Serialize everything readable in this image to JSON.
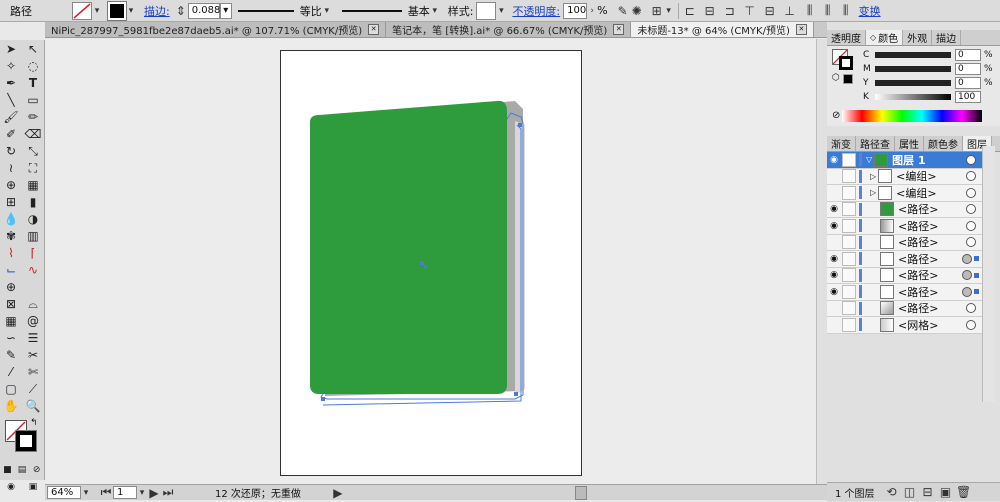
{
  "controlbar": {
    "path_label": "路径",
    "stroke_label": "描边:",
    "stroke_value": "0.088",
    "ratio_label": "等比",
    "profile_label": "基本",
    "style_label": "样式:",
    "opacity_label": "不透明度:",
    "opacity_value": "100",
    "opacity_unit": "%",
    "transform_label": "变换"
  },
  "tabs": [
    {
      "label": "NiPic_287997_5981fbe2e87daeb5.ai* @ 107.71% (CMYK/预览)"
    },
    {
      "label": "笔记本，笔 [转换].ai* @ 66.67% (CMYK/预览)"
    },
    {
      "label": "未标题-13* @ 64% (CMYK/预览)"
    }
  ],
  "color_panel": {
    "tabs": [
      "透明度",
      "颜色",
      "外观",
      "描边"
    ],
    "active_tab": "颜色",
    "channels": [
      {
        "name": "C",
        "value": "0",
        "unit": "%"
      },
      {
        "name": "M",
        "value": "0",
        "unit": "%"
      },
      {
        "name": "Y",
        "value": "0",
        "unit": "%"
      },
      {
        "name": "K",
        "value": "100",
        "unit": ""
      }
    ]
  },
  "layers_panel": {
    "tabs": [
      "渐变",
      "路径查",
      "属性",
      "颜色参",
      "图层"
    ],
    "active_tab": "图层",
    "rows": [
      {
        "label": "图层 1",
        "selected": true
      },
      {
        "label": "<编组>"
      },
      {
        "label": "<编组>"
      },
      {
        "label": "<路径>"
      },
      {
        "label": "<路径>"
      },
      {
        "label": "<路径>"
      },
      {
        "label": "<路径>"
      },
      {
        "label": "<路径>"
      },
      {
        "label": "<路径>"
      },
      {
        "label": "<路径>"
      },
      {
        "label": "<网格>"
      }
    ],
    "footer_label": "1 个图层"
  },
  "statusbar": {
    "zoom": "64%",
    "page": "1",
    "undo_text": "12 次还原；无重做"
  },
  "colors": {
    "book_green": "#2e9c3d",
    "selection_blue": "#4a7bdc",
    "layer_selected": "#3a7bd5"
  }
}
